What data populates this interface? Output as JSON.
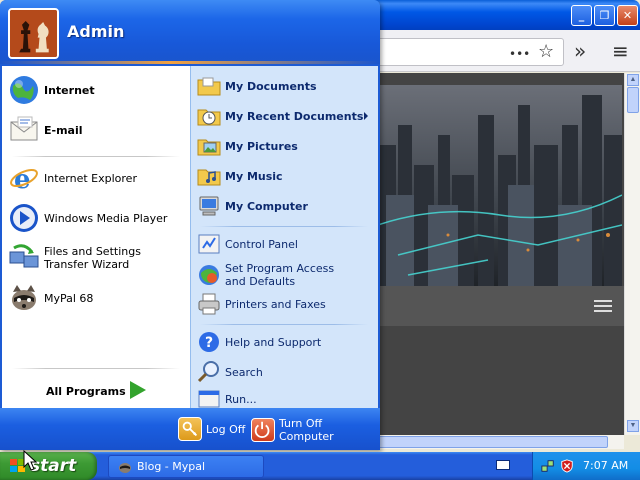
{
  "browser": {
    "title": "",
    "toolbar": {
      "more_glyph": "•••",
      "star_glyph": "☆",
      "chevrons_glyph": "»",
      "menu_glyph": "≡"
    },
    "window_buttons": {
      "minimize": "_",
      "maximize": "❐",
      "close": "✕"
    }
  },
  "start_menu": {
    "user": {
      "name": "Admin",
      "avatar_icon": "chess-pieces-icon"
    },
    "pinned": [
      {
        "label": "Internet",
        "icon": "globe-icon"
      },
      {
        "label": "E-mail",
        "icon": "envelope-icon"
      }
    ],
    "recent": [
      {
        "label": "Internet Explorer",
        "icon": "internet-explorer-icon"
      },
      {
        "label": "Windows Media Player",
        "icon": "media-player-icon"
      },
      {
        "label": "Files and Settings Transfer Wizard",
        "icon": "transfer-wizard-icon"
      },
      {
        "label": "MyPal 68",
        "icon": "mypal-raccoon-icon"
      }
    ],
    "all_programs": "All Programs",
    "places": [
      {
        "label": "My Documents",
        "icon": "folder-documents-icon"
      },
      {
        "label": "My Recent Documents",
        "icon": "recent-documents-icon"
      },
      {
        "label": "My Pictures",
        "icon": "folder-pictures-icon"
      },
      {
        "label": "My Music",
        "icon": "folder-music-icon"
      },
      {
        "label": "My Computer",
        "icon": "computer-icon"
      }
    ],
    "system": [
      {
        "label": "Control Panel",
        "icon": "control-panel-icon"
      },
      {
        "label": "Set Program Access and Defaults",
        "icon": "program-defaults-icon"
      },
      {
        "label": "Printers and Faxes",
        "icon": "printer-icon"
      }
    ],
    "support": [
      {
        "label": "Help and Support",
        "icon": "help-icon"
      },
      {
        "label": "Search",
        "icon": "search-icon"
      },
      {
        "label": "Run...",
        "icon": "run-icon"
      }
    ],
    "footer": {
      "log_off": "Log Off",
      "turn_off": "Turn Off Computer"
    }
  },
  "taskbar": {
    "start_label": "start",
    "task": {
      "label": "Blog - Mypal",
      "icon": "mypal-raccoon-icon"
    },
    "clock": "7:07 AM"
  },
  "colors": {
    "xp_blue": "#245edb",
    "start_green": "#3d9a34",
    "places_panel": "#d3e5fa"
  }
}
